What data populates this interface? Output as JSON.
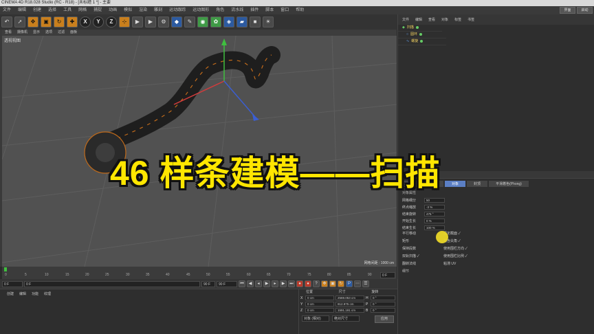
{
  "window": {
    "title": "CINEMA 4D R18.028 Studio (RC - R18) - [未标题 1 *] - 主要"
  },
  "menu": [
    "文件",
    "编辑",
    "创建",
    "选择",
    "工具",
    "网格",
    "捕捉",
    "动画",
    "模拟",
    "渲染",
    "雕刻",
    "运动跟踪",
    "运动图形",
    "角色",
    "流水线",
    "插件",
    "脚本",
    "窗口",
    "帮助"
  ],
  "layout_buttons": [
    "界面",
    "启动"
  ],
  "toolbar": {
    "axis_labels": [
      "X",
      "Y",
      "Z"
    ]
  },
  "viewport": {
    "menu": [
      "查看",
      "摄像机",
      "显示",
      "选项",
      "过滤",
      "面板"
    ],
    "label": "透视视图",
    "scale": "网格间距 : 1000 cm"
  },
  "timeline": {
    "ticks": [
      "0",
      "5",
      "10",
      "15",
      "20",
      "25",
      "30",
      "35",
      "40",
      "45",
      "50",
      "55",
      "60",
      "65",
      "70",
      "75",
      "80",
      "85",
      "90"
    ],
    "frame_display": "0 F",
    "start_field": "0 F",
    "current_field": "0 F",
    "end_field": "90 F",
    "end_field2": "90 F"
  },
  "materials": {
    "menu": [
      "创建",
      "编辑",
      "功能",
      "纹理"
    ]
  },
  "coordinates": {
    "headers": [
      "位置",
      "尺寸",
      "旋转"
    ],
    "rows": [
      {
        "axis": "X",
        "pos": "0 cm",
        "size": "2569.053 cm",
        "rot_axis": "H",
        "rot": "0 °"
      },
      {
        "axis": "Y",
        "pos": "0 cm",
        "size": "812.975 cm",
        "rot_axis": "P",
        "rot": "0 °"
      },
      {
        "axis": "Z",
        "pos": "0 cm",
        "size": "1591.191 cm",
        "rot_axis": "B",
        "rot": "0 °"
      }
    ],
    "mode_select": "对象 (相对)",
    "size_select": "绝对尺寸",
    "apply_label": "应用"
  },
  "object_manager": {
    "menu": [
      "文件",
      "编辑",
      "查看",
      "对象",
      "标签",
      "书签"
    ],
    "objects": [
      {
        "name": "扫描"
      },
      {
        "name": "圆环"
      },
      {
        "name": "螺旋"
      }
    ]
  },
  "attributes": {
    "tabs": [
      "基本",
      "坐标",
      "对象",
      "封顶",
      "平滑着色(Phong)"
    ],
    "active_tab": "对象",
    "section": "对象属性",
    "params": [
      {
        "label": "网格细分",
        "value": "50"
      },
      {
        "label": "终点缩放",
        "value": "-3 %"
      },
      {
        "label": "结束旋转",
        "value": "475 °"
      },
      {
        "label": "开始生长",
        "value": "0 %"
      },
      {
        "label": "结束生长",
        "value": "100 %"
      }
    ],
    "checks": [
      {
        "label": "平行移动",
        "checked": ""
      },
      {
        "label": "恒定截面",
        "checked": "✓"
      },
      {
        "label": "矩形",
        "checked": ""
      },
      {
        "label": "包含尖角",
        "checked": "✓"
      },
      {
        "label": "保持段数",
        "checked": ""
      },
      {
        "label": "使用围栏方向",
        "checked": "✓"
      },
      {
        "label": "双轨扫描",
        "checked": "✓"
      },
      {
        "label": "使用围栏比例",
        "checked": "✓"
      },
      {
        "label": "翻转法线",
        "checked": ""
      },
      {
        "label": "粘滞 UV",
        "checked": ""
      }
    ],
    "detail": "细节"
  },
  "overlay": {
    "headline": "46 样条建模——扫描"
  },
  "colors": {
    "accent": "#ffe600",
    "cursor": "#ebd728",
    "active_tab": "#5b7fc4"
  }
}
